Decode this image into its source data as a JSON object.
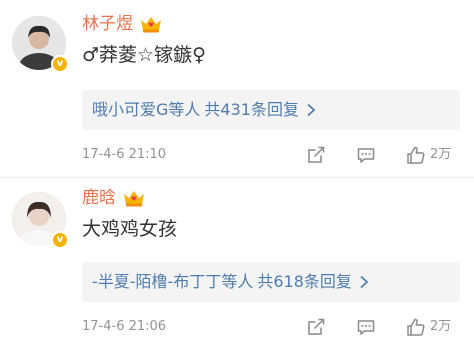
{
  "comments": [
    {
      "username": "林子煜",
      "text": "♂莽菱☆镓鏃♀",
      "reply_users": "哦小可爱G等人",
      "reply_count": "共431条回复",
      "time": "17-4-6 21:10",
      "likes": "2万",
      "avatar_icon": "user-avatar-icon",
      "badge_icon": "verified-v-icon",
      "crown_icon": "crown-member-icon"
    },
    {
      "username": "鹿晗",
      "text": "大鸡鸡女孩",
      "reply_users": "-半夏-陌橹-布丁丁等人",
      "reply_count": "共618条回复",
      "time": "17-4-6 21:06",
      "likes": "2万",
      "avatar_icon": "user-avatar-icon",
      "badge_icon": "verified-v-icon",
      "crown_icon": "crown-member-icon"
    }
  ],
  "badge_glyph": "v",
  "colors": {
    "username": "#eb7350",
    "reply_link": "#507daf",
    "meta": "#939393",
    "text": "#333333",
    "reply_bg": "#f4f4f4",
    "badge": "#f4b400"
  }
}
